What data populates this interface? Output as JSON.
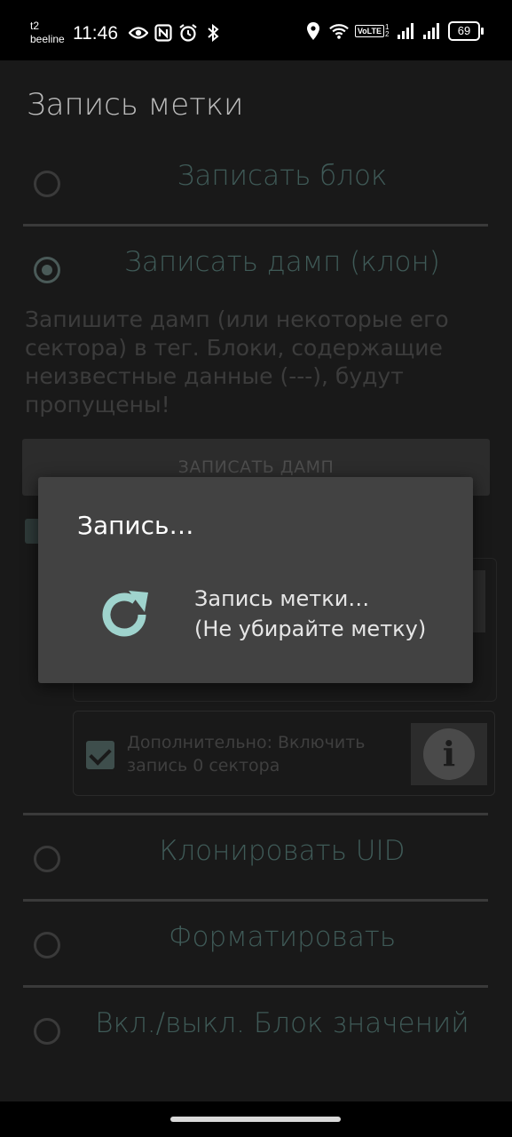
{
  "status_bar": {
    "carrier_top": "t2",
    "carrier_bottom": "beeline",
    "time": "11:46",
    "volte": "VoLTE",
    "volte_sim": "1 2",
    "battery": "69"
  },
  "app": {
    "title": "Запись метки"
  },
  "options": [
    {
      "label": "Записать блок",
      "checked": false
    },
    {
      "label": "Записать дамп (клон)",
      "checked": true
    },
    {
      "label": "Клонировать UID",
      "checked": false
    },
    {
      "label": "Форматировать",
      "checked": false
    },
    {
      "label": "Вкл./выкл. Блок значений",
      "checked": false
    }
  ],
  "dump": {
    "description": "Запишите дамп (или некоторые его сектора) в тег. Блоки, содержащие неизвестные данные (---), будут пропущены!",
    "button_label": "ЗАПИСАТЬ ДАМП",
    "extra_label": "Дополнительно: Включить запись 0 сектора",
    "extra_checked": true,
    "info_symbol": "i"
  },
  "dialog": {
    "title": "Запись…",
    "message_line1": "Запись метки…",
    "message_line2": "(Не убирайте метку)",
    "icon_color": "#9fd3cd"
  },
  "colors": {
    "accent_dim": "#3f5a57",
    "dialog_bg": "#424242",
    "background": "#191919"
  }
}
